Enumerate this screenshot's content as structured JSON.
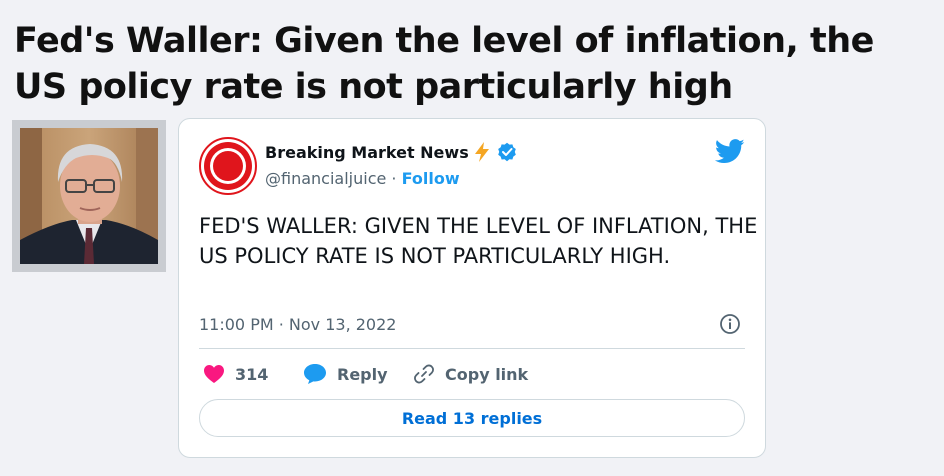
{
  "headline": "Fed's Waller: Given the level of inflation, the US policy rate is not particularly high",
  "tweet": {
    "author_name": "Breaking Market News",
    "handle": "@financialjuice",
    "separator": " · ",
    "follow_label": "Follow",
    "text": "FED'S WALLER: GIVEN THE LEVEL OF INFLATION, THE US POLICY RATE IS NOT PARTICULARLY HIGH.",
    "timestamp": "11:00 PM · Nov 13, 2022",
    "likes": "314",
    "reply_label": "Reply",
    "copy_link_label": "Copy link",
    "read_replies_label": "Read 13 replies"
  },
  "icons": {
    "bolt": "lightning-bolt-icon",
    "verified": "verified-badge-icon",
    "twitter": "twitter-bird-icon",
    "info": "info-icon",
    "like": "heart-icon",
    "reply": "speech-bubble-icon",
    "copy": "link-icon"
  },
  "colors": {
    "accent": "#1d9bf0",
    "like": "#f91880",
    "bolt": "#f5a623",
    "avatar_red": "#e0151c"
  }
}
